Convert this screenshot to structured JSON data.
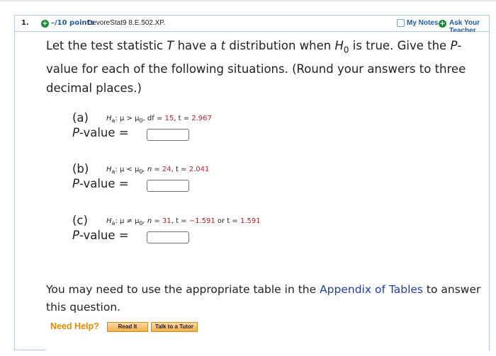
{
  "question": {
    "number": "1.",
    "points": "–/10 points",
    "source_code": "DevoreStat9 8.E.502.XP.",
    "my_notes_label": "My Notes",
    "ask_teacher_label": "Ask Your Teacher"
  },
  "intro_text": {
    "p1": "Let the test statistic ",
    "T": "T",
    "p2": " have a ",
    "t": "t",
    "p3": " distribution when ",
    "H": "H",
    "sub0": "0",
    "p4": " is true. Give the ",
    "P": "P",
    "p5": "-value for each of the following situations. (Round your answers to three decimal places.)"
  },
  "parts": [
    {
      "label": "(a)",
      "hyp_H": "H",
      "hyp_sub": "a",
      "hyp_rel": ": μ > μ",
      "hyp_sub0": "0",
      "hyp_rest1": ", df = ",
      "v1": "15",
      "hyp_rest2": ", t = ",
      "v2": "2.967",
      "pvalue_label": "P-value =",
      "answer": ""
    },
    {
      "label": "(b)",
      "hyp_H": "H",
      "hyp_sub": "a",
      "hyp_rel": ": μ < μ",
      "hyp_sub0": "0",
      "hyp_rest1": ", n = ",
      "v1": "24",
      "hyp_rest2": ", t = ",
      "v2": "2.041",
      "pvalue_label": "P-value =",
      "answer": ""
    },
    {
      "label": "(c)",
      "hyp_H": "H",
      "hyp_sub": "a",
      "hyp_rel": ": μ ≠ μ",
      "hyp_sub0": "0",
      "hyp_rest1": ", n = ",
      "v1": "31",
      "hyp_rest2": ", t = ",
      "v2": "−1.591",
      "hyp_rest3": " or t = ",
      "v3": "1.591",
      "pvalue_label": "P-value =",
      "answer": ""
    }
  ],
  "footer": {
    "text1": "You may need to use the appropriate table in the ",
    "link": "Appendix of Tables",
    "text2": " to answer this question."
  },
  "help": {
    "need_help": "Need Help?",
    "read_it": "Read It",
    "talk_tutor": "Talk to a Tutor"
  },
  "colors": {
    "link_blue": "#1f5ba8",
    "value_red": "#b8202a",
    "help_orange": "#e58b00"
  }
}
